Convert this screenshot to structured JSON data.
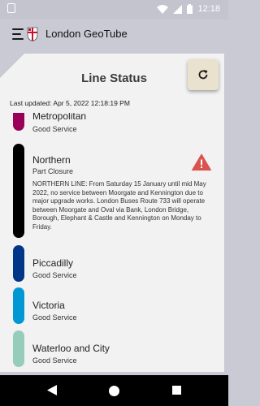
{
  "status_bar": {
    "time": "12:18"
  },
  "app": {
    "title": "London GeoTube"
  },
  "card": {
    "title": "Line Status",
    "last_updated": "Last updated: Apr 5, 2022 12:18:19 PM"
  },
  "lines": [
    {
      "name": "Metropolitan",
      "status": "Good Service",
      "color": "#9b0058"
    },
    {
      "name": "Northern",
      "status": "Part Closure",
      "color": "#000000",
      "description": "NORTHERN LINE: From Saturday 15 January until mid May 2022, no service between Moorgate and Kennington due to major upgrade works. London Buses Route 733 will operate between Moorgate and Oval via Bank, London Bridge, Borough, Elephant & Castle and Kennington on Monday to Friday.",
      "icon": "warning-icon"
    },
    {
      "name": "Piccadilly",
      "status": "Good Service",
      "color": "#003688"
    },
    {
      "name": "Victoria",
      "status": "Good Service",
      "color": "#0098d4"
    },
    {
      "name": "Waterloo and City",
      "status": "Good Service",
      "color": "#95cdba"
    }
  ],
  "colors": {
    "warning": "#d9534f",
    "refresh_bg": "#e9e2ce"
  }
}
